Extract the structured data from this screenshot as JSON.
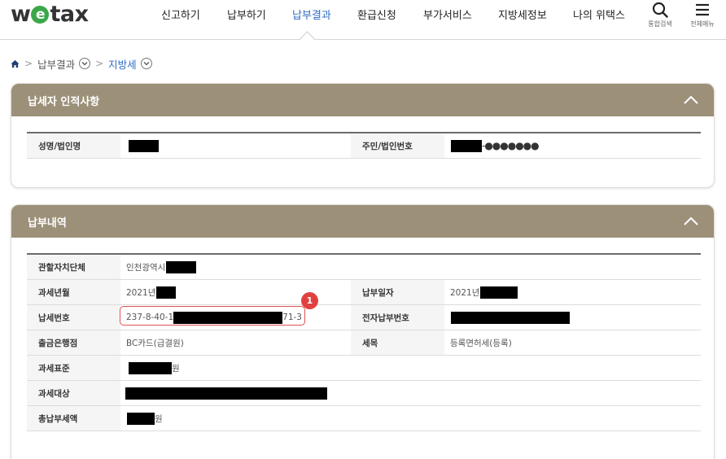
{
  "logo": {
    "part1": "w",
    "part2": "e",
    "part3": "tax"
  },
  "nav": {
    "items": [
      "신고하기",
      "납부하기",
      "납부결과",
      "환급신청",
      "부가서비스",
      "지방세정보",
      "나의 위택스"
    ],
    "active_index": 2
  },
  "tools": {
    "search_label": "통합검색",
    "menu_label": "전체메뉴"
  },
  "breadcrumb": {
    "level1": "납부결과",
    "level2": "지방세"
  },
  "taxpayer_section": {
    "title": "납세자 인적사항",
    "name_label": "성명/법인명",
    "id_label": "주민/법인번호",
    "id_masked": "-●●●●●●●"
  },
  "payment_section": {
    "title": "납부내역",
    "local_gov_label": "관할자치단체",
    "local_gov_value": "인천광역시",
    "tax_year_month_label": "과세년월",
    "tax_year_month_value": "2021년",
    "payment_date_label": "납부일자",
    "payment_date_value": "2021년",
    "tax_number_label": "납세번호",
    "tax_number_prefix": "237-8-40-1",
    "tax_number_suffix": "71-3",
    "e_payment_no_label": "전자납부번호",
    "bank_label": "출금은행점",
    "bank_value": "BC카드(급결원)",
    "tax_item_label": "세목",
    "tax_item_value": "등록면허세(등록)",
    "tax_base_label": "과세표준",
    "won_unit": "원",
    "tax_object_label": "과세대상",
    "total_label": "총납부세액"
  },
  "annotation": {
    "badge_number": "1",
    "badge_color": "#e0413f"
  },
  "colors": {
    "panel_header": "#9c9079",
    "active_nav": "#2f6bc4",
    "logo_e": "#3aa84a"
  }
}
